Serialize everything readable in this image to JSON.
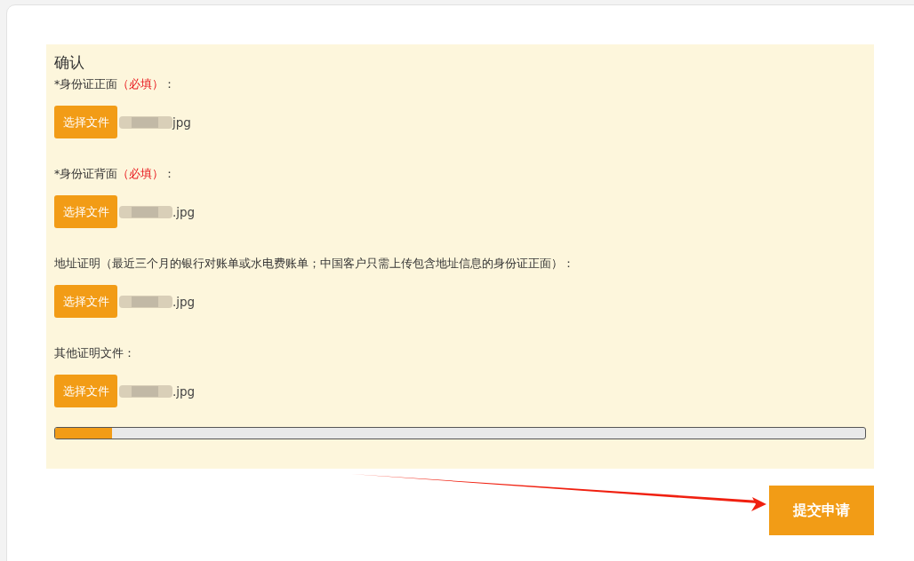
{
  "section_title": "确认",
  "fields": [
    {
      "label": "*身份证正面",
      "note": "（必填）",
      "tail": "：",
      "button": "选择文件",
      "file_name": "jpg"
    },
    {
      "label": "*身份证背面",
      "note": "（必填）",
      "tail": "：",
      "button": "选择文件",
      "file_name": ".jpg"
    },
    {
      "label": "地址证明（最近三个月的银行对账单或水电费账单；中国客户只需上传包含地址信息的身份证正面）",
      "tail": "：",
      "button": "选择文件",
      "file_name": ".jpg"
    },
    {
      "label": "其他证明文件",
      "tail": "：",
      "button": "选择文件",
      "file_name": ".jpg"
    }
  ],
  "progress": {
    "level": 0.07
  },
  "submit_button": "提交申请"
}
